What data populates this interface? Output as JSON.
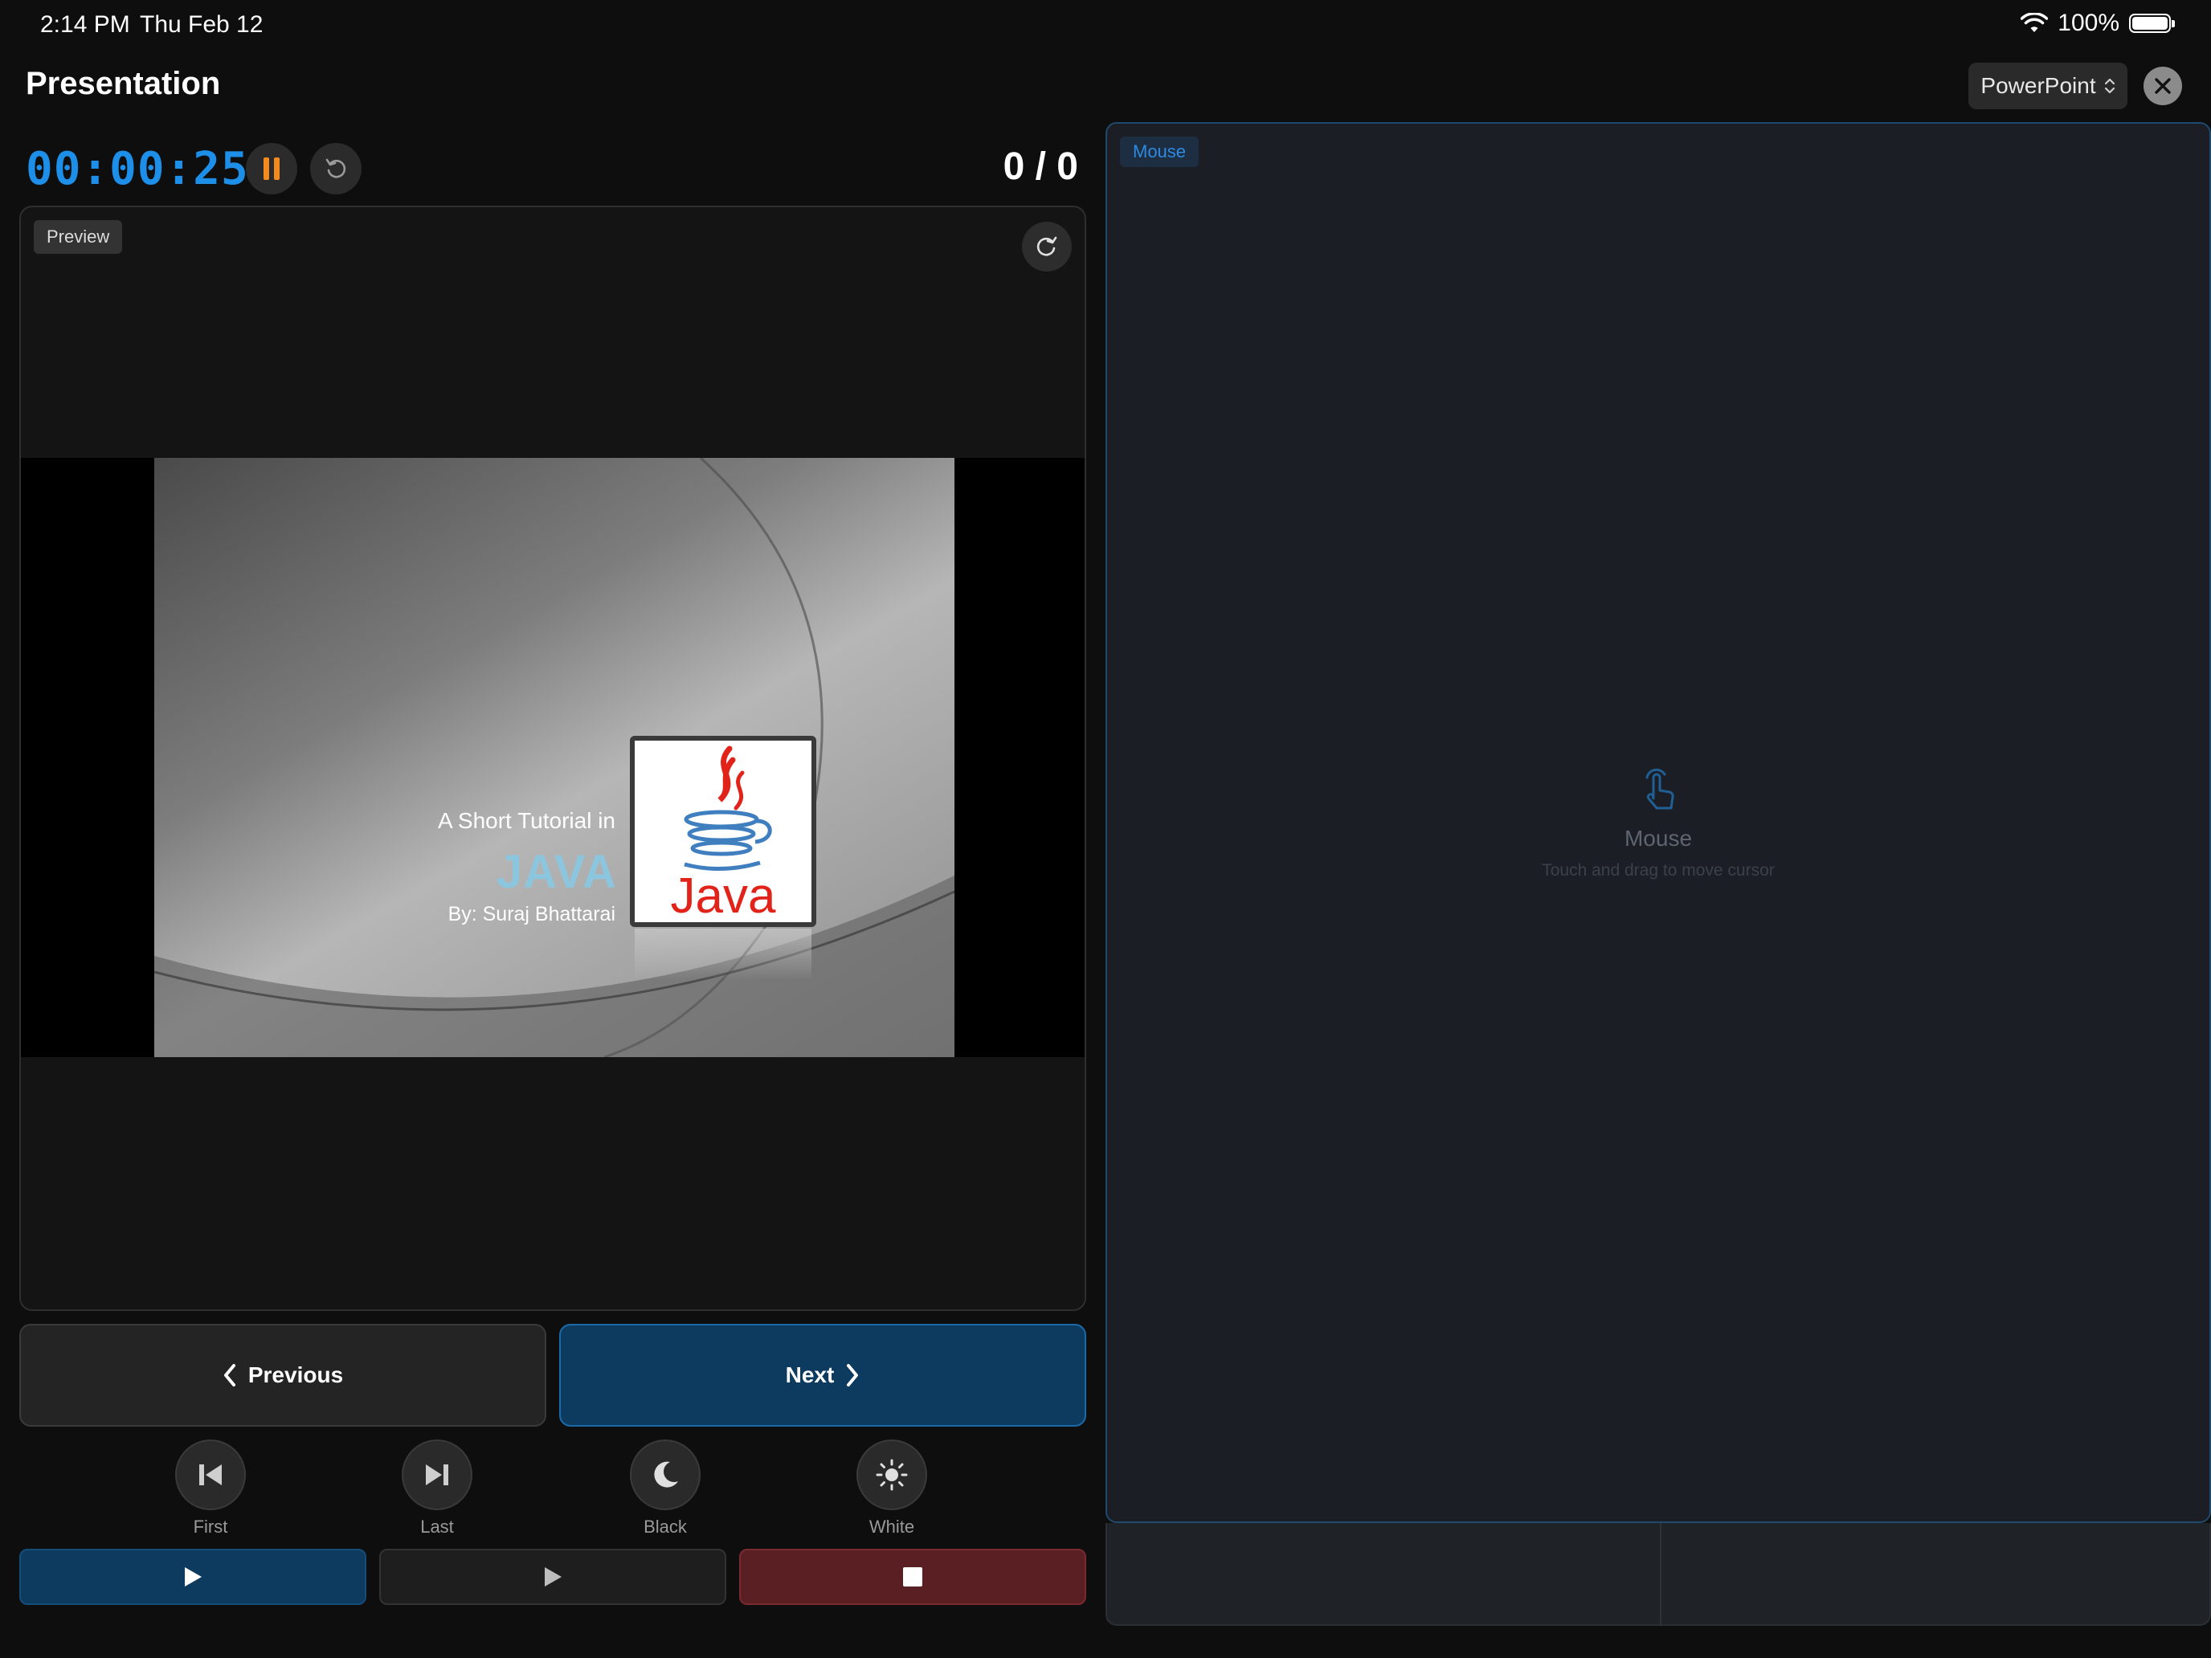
{
  "status_bar": {
    "time": "2:14 PM",
    "date": "Thu Feb 12",
    "battery": "100%"
  },
  "header": {
    "title": "Presentation",
    "app_selector": "PowerPoint"
  },
  "timer": {
    "elapsed": "00:00:25",
    "slide_counter": "0 / 0"
  },
  "preview": {
    "badge": "Preview",
    "slide": {
      "line1": "A Short Tutorial in",
      "line2": "JAVA",
      "line3": "By: Suraj Bhattarai",
      "logo_text": "Java"
    }
  },
  "nav": {
    "previous_label": "Previous",
    "next_label": "Next"
  },
  "utilities": [
    {
      "label": "First",
      "icon": "skip-first-icon"
    },
    {
      "label": "Last",
      "icon": "skip-last-icon"
    },
    {
      "label": "Black",
      "icon": "moon-icon"
    },
    {
      "label": "White",
      "icon": "sun-icon"
    }
  ],
  "mouse": {
    "badge": "Mouse",
    "label": "Mouse",
    "hint": "Touch and drag to move cursor"
  },
  "colors": {
    "accent": "#1e8fe8",
    "pause": "#f28a1e",
    "next_bg": "#0d3a5f",
    "stop_bg": "#5a1f22"
  }
}
